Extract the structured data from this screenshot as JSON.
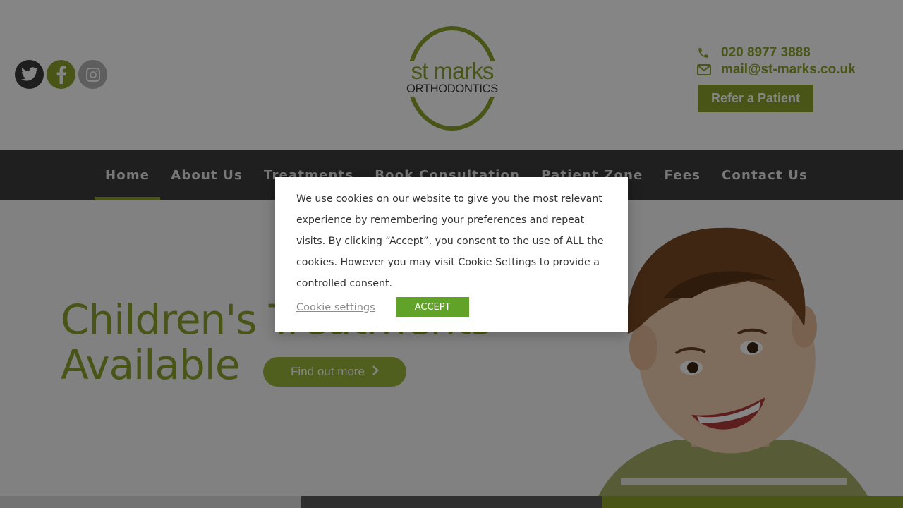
{
  "social": {
    "icons": [
      "twitter-icon",
      "facebook-icon",
      "instagram-icon"
    ]
  },
  "logo": {
    "line1": "st marks",
    "line2": "ORTHODONTICS"
  },
  "contact": {
    "phone": "020 8977 3888",
    "email": "mail@st-marks.co.uk",
    "refer_label": "Refer a Patient"
  },
  "nav": {
    "items": [
      "Home",
      "About Us",
      "Treatments",
      "Book Consultation",
      "Patient Zone",
      "Fees",
      "Contact Us"
    ],
    "active": "Home"
  },
  "hero": {
    "title_line1": "Children's Treatments",
    "title_line2": "Available",
    "button_label": "Find out more"
  },
  "cookie": {
    "message": "We use cookies on our website to give you the most relevant experience by remembering your preferences and repeat visits. By clicking “Accept”, you consent to the use of ALL the cookies. However you may visit Cookie Settings to provide a controlled consent.",
    "settings_label": "Cookie settings",
    "accept_label": "ACCEPT"
  },
  "colors": {
    "brand_green": "#8aa32c",
    "accept_green": "#61a229",
    "nav_bg": "#3d3d3d"
  }
}
